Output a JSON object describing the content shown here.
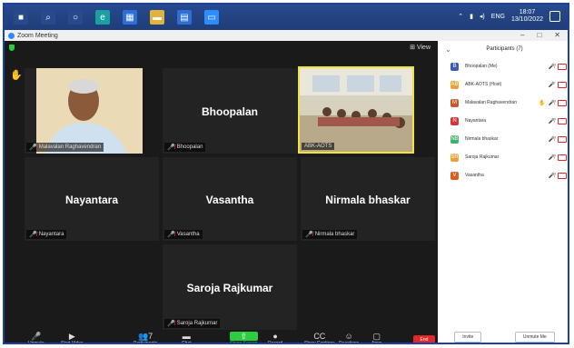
{
  "window": {
    "title": "Zoom Meeting",
    "controls": [
      "–",
      "□",
      "✕"
    ]
  },
  "taskbar": {
    "apps": [
      {
        "icon": "windows-start-icon",
        "glyph": "■",
        "bg": "#274a8e"
      },
      {
        "icon": "search-icon",
        "glyph": "⌕",
        "bg": "#274a8e"
      },
      {
        "icon": "task-view-icon",
        "glyph": "○",
        "bg": "#274a8e"
      },
      {
        "icon": "edge-icon",
        "glyph": "e",
        "bg": "#1aa0a0"
      },
      {
        "icon": "store-icon",
        "glyph": "▦",
        "bg": "#2d6fd6"
      },
      {
        "icon": "folder-icon",
        "glyph": "▬",
        "bg": "#e2b33c"
      },
      {
        "icon": "mail-icon",
        "glyph": "▤",
        "bg": "#2d6fd6"
      },
      {
        "icon": "zoom-app-icon",
        "glyph": "▭",
        "bg": "#2d8cff"
      }
    ],
    "time": "18:07",
    "date": "13/10/2022",
    "lang": "ENG"
  },
  "meeting": {
    "view_label": "View",
    "tiles": [
      {
        "name": "",
        "label": "Malavalan Raghavendran",
        "type": "video-man"
      },
      {
        "name": "Bhoopalan",
        "label": "Bhoopalan",
        "type": "name"
      },
      {
        "name": "",
        "label": "ABK-AOTS",
        "type": "video-room"
      },
      {
        "name": "Nayantara",
        "label": "Nayantara",
        "type": "name"
      },
      {
        "name": "Vasantha",
        "label": "Vasantha",
        "type": "name"
      },
      {
        "name": "Nirmala bhaskar",
        "label": "Nirmala bhaskar",
        "type": "name"
      },
      {
        "name": "Saroja Rajkumar",
        "label": "Saroja Rajkumar",
        "type": "name"
      }
    ]
  },
  "toolbar": {
    "items": [
      {
        "label": "Unmute",
        "icon": "microphone-muted-icon",
        "glyph": "🎤"
      },
      {
        "label": "Start Video",
        "icon": "camera-off-icon",
        "glyph": "▶"
      },
      {
        "label": "Participants",
        "icon": "participants-icon",
        "glyph": "👥",
        "badge": "7"
      },
      {
        "label": "Chat",
        "icon": "chat-icon",
        "glyph": "▬"
      },
      {
        "label": "Share Screen",
        "icon": "share-screen-icon",
        "glyph": "⇧"
      },
      {
        "label": "Record",
        "icon": "record-icon",
        "glyph": "●"
      },
      {
        "label": "Show Captions",
        "icon": "captions-icon",
        "glyph": "CC"
      },
      {
        "label": "Reactions",
        "icon": "reactions-icon",
        "glyph": "☺"
      },
      {
        "label": "Apps",
        "icon": "apps-icon",
        "glyph": "▢"
      }
    ],
    "end_label": "End"
  },
  "participants": {
    "title": "Participants (7)",
    "list": [
      {
        "name": "Bhoopalan (Me)",
        "initial": "B",
        "color": "#3b5bb5",
        "hand": false
      },
      {
        "name": "ABK-AOTS (Host)",
        "initial": "AB",
        "color": "#e8a43a",
        "hand": false
      },
      {
        "name": "Malavalan Raghavendran",
        "initial": "M",
        "color": "#c65a2a",
        "hand": true
      },
      {
        "name": "Nayantara",
        "initial": "N",
        "color": "#d6343a",
        "hand": false
      },
      {
        "name": "Nirmala bhaskar",
        "initial": "NB",
        "color": "#3fb26b",
        "hand": false
      },
      {
        "name": "Saroja Rajkumar",
        "initial": "SR",
        "color": "#e8a43a",
        "hand": false
      },
      {
        "name": "Vasantha",
        "initial": "V",
        "color": "#d65e1e",
        "hand": false
      }
    ],
    "invite_label": "Invite",
    "unmute_me_label": "Unmute Me"
  }
}
